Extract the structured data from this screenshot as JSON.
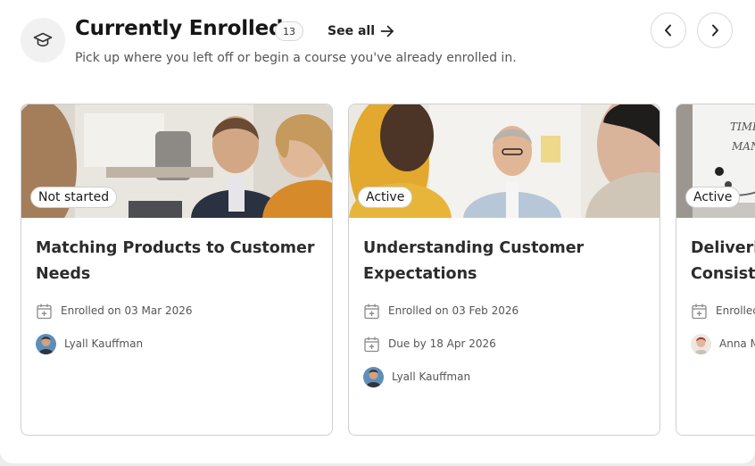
{
  "header": {
    "title": "Currently Enrolled",
    "count": "13",
    "see_all_label": "See all",
    "subtitle": "Pick up where you left off or begin a course you've already enrolled in.",
    "icon": "graduation-cap-icon"
  },
  "nav": {
    "prev_icon": "chevron-left-icon",
    "next_icon": "chevron-right-icon"
  },
  "cards": [
    {
      "status": "Not started",
      "title_line1": "Matching Products to Customer",
      "title_line2": "Needs",
      "enrolled": "Enrolled on 03 Mar 2026",
      "instructor": "Lyall Kauffman"
    },
    {
      "status": "Active",
      "title_line1": "Understanding Customer",
      "title_line2": "Expectations",
      "enrolled": "Enrolled on 03 Feb 2026",
      "due": "Due by 18 Apr 2026",
      "instructor": "Lyall Kauffman"
    },
    {
      "status": "Active",
      "title_line1": "Deliverin",
      "title_line2": "Consiste",
      "enrolled": "Enrollec",
      "instructor": "Anna M"
    }
  ]
}
